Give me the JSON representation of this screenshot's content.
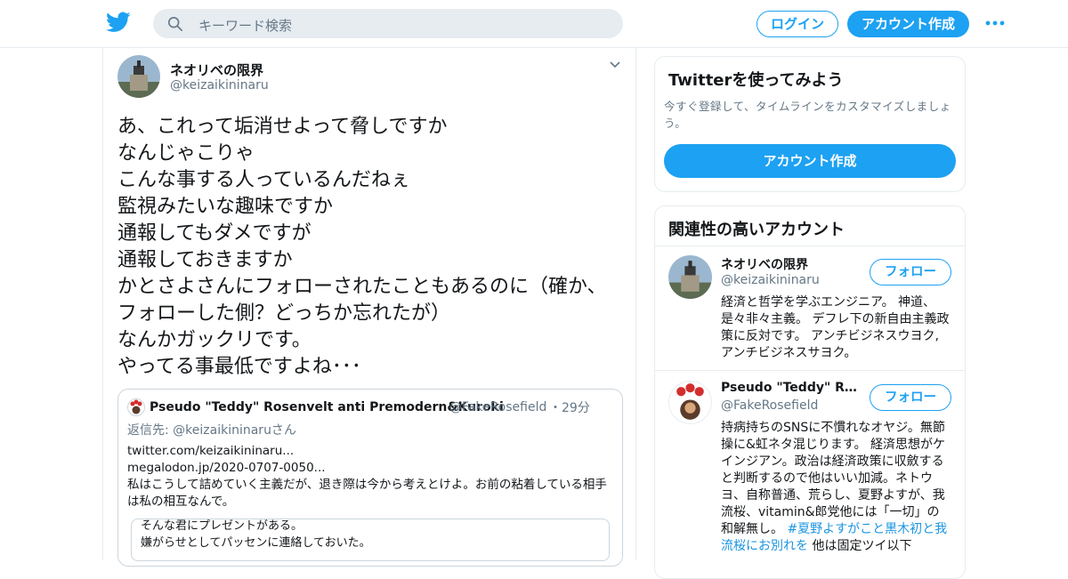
{
  "header": {
    "search_placeholder": "キーワード検索",
    "login_label": "ログイン",
    "signup_label": "アカウント作成"
  },
  "tweet": {
    "author_name": "ネオリベの限界",
    "author_handle": "@keizaikininaru",
    "text": "あ、これって垢消せよって脅しですか\nなんじゃこりゃ\nこんな事する人っているんだねぇ\n監視みたいな趣味ですか\n通報してもダメですが\n通報しておきますか\nかとさよさんにフォローされたこともあるのに（確か、フォローした側？どっちか忘れたが）\nなんかガックリです。\nやってる事最低ですよね･･･",
    "quoted": {
      "name": "Pseudo \"Teddy\" Rosenvelt anti Premodern&Kuroki",
      "handle": "@FakeRosefield",
      "time": "・29分",
      "reply_to": "返信先: @keizaikininaruさん",
      "text": "twitter.com/keizaikininaru...\nmegalodon.jp/2020-0707-0050...\n私はこうして詰めていく主義だが、退き際は今から考えとけよ。お前の粘着している相手は私の相互なんで。",
      "inner_text": "そんな君にプレゼントがある。\n嫌がらせとしてパッセンに連絡しておいた。"
    }
  },
  "sidebar": {
    "signup_card": {
      "title": "Twitterを使ってみよう",
      "desc": "今すぐ登録して、タイムラインをカスタマイズしましょう。",
      "button": "アカウント作成"
    },
    "related": {
      "title": "関連性の高いアカウント",
      "follow_label": "フォロー",
      "accounts": [
        {
          "name": "ネオリベの限界",
          "handle": "@keizaikininaru",
          "bio": "経済と哲学を学ぶエンジニア。 神道、是々非々主義。 デフレ下の新自由主義政策に反対です。 アンチビジネスウヨク, アンチビジネスサヨク。"
        },
        {
          "name": "Pseudo \"Teddy\" Rosenvelt anti Premodern&Kuroki",
          "handle": "@FakeRosefield",
          "bio_pre": "持病持ちのSNSに不慣れなオヤジ。無節操に&虹ネタ混じります。 経済思想がケインジアン。政治は経済政策に収斂すると判断するので他はいい加減。ネトウヨ、自称普通、荒らし、夏野よすが、我流桜、vitamin&郎党他には「一切」の和解無し。",
          "bio_link": "#夏野よすがこと黒木初と我流桜にお別れを",
          "bio_post": " 他は固定ツイ以下"
        }
      ]
    }
  },
  "colors": {
    "accent": "#1da1f2",
    "secondary_text": "#657786",
    "border": "#e6ecf0"
  }
}
